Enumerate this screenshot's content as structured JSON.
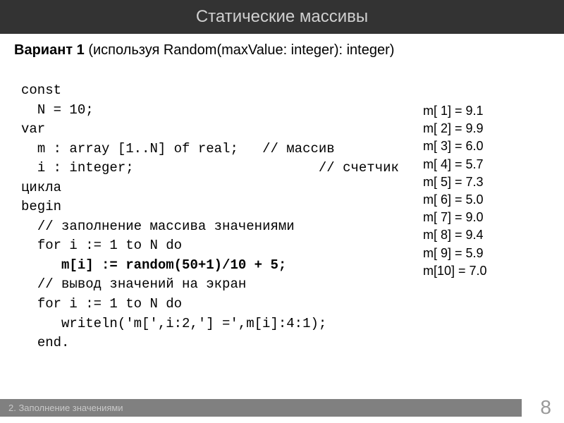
{
  "header": {
    "title": "Статические массивы"
  },
  "subtitle": {
    "bold": "Вариант 1",
    "rest": " (используя  Random(maxValue: integer): integer)"
  },
  "code": {
    "line1": "const",
    "line2": "  N = 10;",
    "line3": "var",
    "line4": "  m : array [1..N] of real;   // массив",
    "line5": "  i : integer;                       // счетчик цикла",
    "line6": "begin",
    "line7": "  // заполнение массива значениями",
    "line8": "  for i := 1 to N do",
    "line9_bold": "     m[i] := random(50+1)/10 + 5;",
    "line10": "  // вывод значений на экран",
    "line11": "  for i := 1 to N do",
    "line12": "     writeln('m[',i:2,'] =',m[i]:4:1);",
    "line13": "  end."
  },
  "output": {
    "lines": [
      "m[ 1] = 9.1",
      "m[ 2] = 9.9",
      "m[ 3] = 6.0",
      "m[ 4] = 5.7",
      "m[ 5] = 7.3",
      "m[ 6] = 5.0",
      "m[ 7] = 9.0",
      "m[ 8] = 9.4",
      "m[ 9] = 5.9",
      "m[10] = 7.0"
    ]
  },
  "footer": {
    "text": "2. Заполнение значениями",
    "page": "8"
  }
}
